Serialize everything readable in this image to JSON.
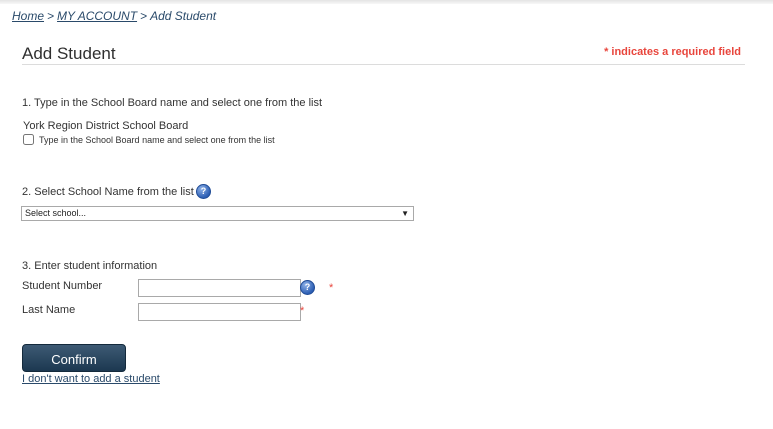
{
  "breadcrumb": {
    "home": "Home",
    "separator": ">",
    "account": "MY ACCOUNT",
    "current": "Add Student"
  },
  "page": {
    "title": "Add Student",
    "required_note": "* indicates a required field"
  },
  "step1": {
    "label": "1. Type in the School Board name and select one from the list",
    "selected_board": "York Region District School Board",
    "checkbox_label": "Type in the School Board name and select one from the list",
    "checkbox_checked": false
  },
  "step2": {
    "label": "2. Select School Name from the list",
    "help_icon": "question-icon",
    "select_value": "Select school..."
  },
  "step3": {
    "label": "3. Enter student information",
    "student_number_label": "Student Number",
    "student_number_value": "",
    "last_name_label": "Last Name",
    "last_name_value": "",
    "required_marker": "*"
  },
  "actions": {
    "confirm_label": "Confirm",
    "skip_link": "I don't want to add a student"
  },
  "colors": {
    "required": "#e8453c",
    "button": "#1c3850",
    "link": "#2a4a6a"
  }
}
